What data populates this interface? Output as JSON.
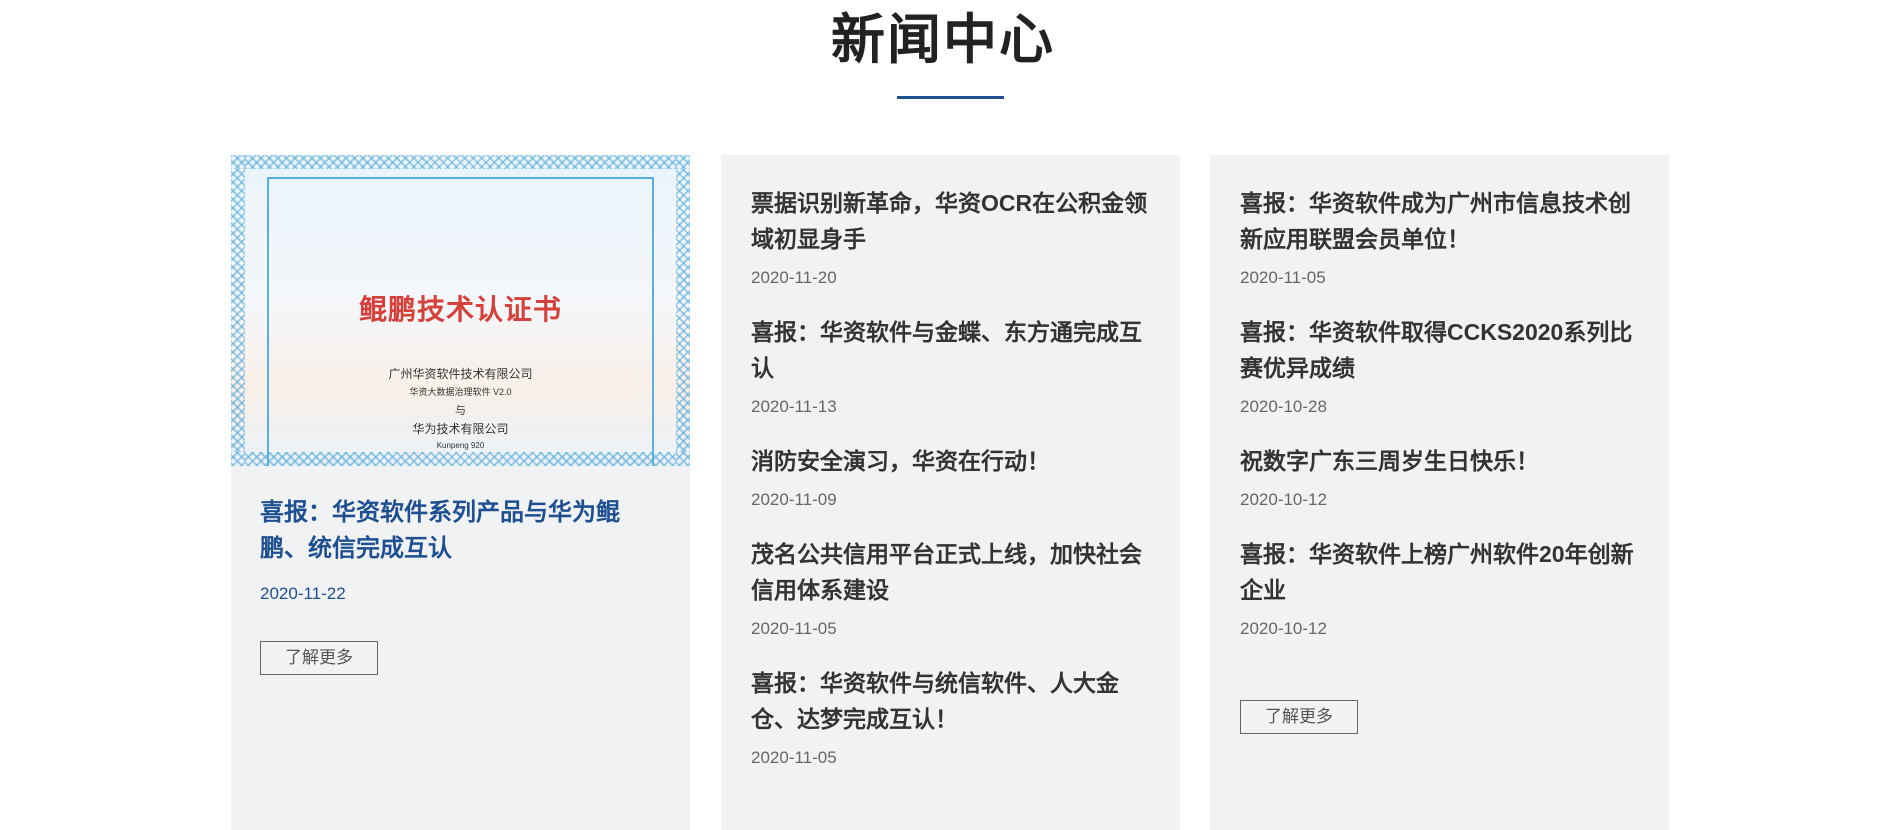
{
  "section": {
    "title": "新闻中心"
  },
  "colors": {
    "accent": "#1d4f91",
    "card_bg": "#f1f2f4",
    "cert_title": "#d5403a"
  },
  "featured": {
    "image": {
      "title": "鲲鹏技术认证书",
      "line1": "广州华资软件技术有限公司",
      "line2": "华资大数据治理软件 V2.0",
      "line3": "与",
      "line4": "华为技术有限公司",
      "line5": "Kunpeng 920"
    },
    "title": "喜报：华资软件系列产品与华为鲲鹏、统信完成互认",
    "date": "2020-11-22",
    "more_label": "了解更多"
  },
  "column2": [
    {
      "title": "票据识别新革命，华资OCR在公积金领域初显身手",
      "date": "2020-11-20"
    },
    {
      "title": "喜报：华资软件与金蝶、东方通完成互认",
      "date": "2020-11-13"
    },
    {
      "title": "消防安全演习，华资在行动！",
      "date": "2020-11-09"
    },
    {
      "title": "茂名公共信用平台正式上线，加快社会信用体系建设",
      "date": "2020-11-05"
    },
    {
      "title": "喜报：华资软件与统信软件、人大金仓、达梦完成互认！",
      "date": "2020-11-05"
    }
  ],
  "column3": {
    "items": [
      {
        "title": "喜报：华资软件成为广州市信息技术创新应用联盟会员单位！",
        "date": "2020-11-05"
      },
      {
        "title": "喜报：华资软件取得CCKS2020系列比赛优异成绩",
        "date": "2020-10-28"
      },
      {
        "title": "祝数字广东三周岁生日快乐！",
        "date": "2020-10-12"
      },
      {
        "title": "喜报：华资软件上榜广州软件20年创新企业",
        "date": "2020-10-12"
      }
    ],
    "more_label": "了解更多"
  }
}
